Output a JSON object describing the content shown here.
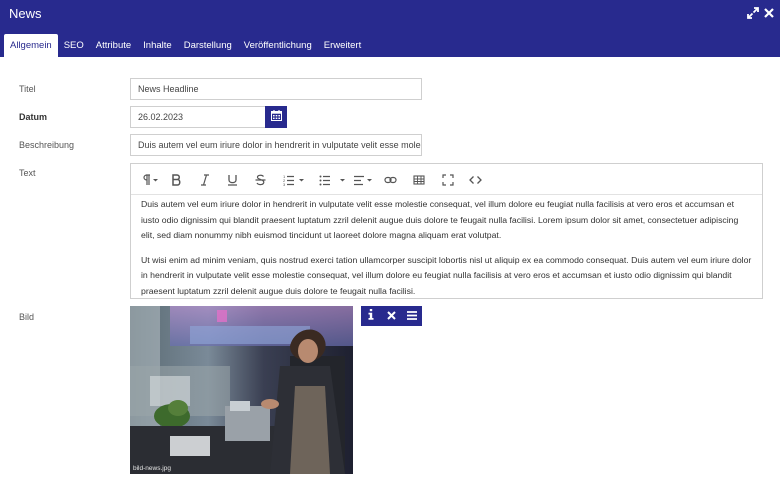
{
  "window": {
    "title": "News"
  },
  "tabs": [
    {
      "label": "Allgemein",
      "active": true
    },
    {
      "label": "SEO",
      "active": false
    },
    {
      "label": "Attribute",
      "active": false
    },
    {
      "label": "Inhalte",
      "active": false
    },
    {
      "label": "Darstellung",
      "active": false
    },
    {
      "label": "Veröffentlichung",
      "active": false
    },
    {
      "label": "Erweitert",
      "active": false
    }
  ],
  "form": {
    "title": {
      "label": "Titel",
      "value": "News Headline"
    },
    "date": {
      "label": "Datum",
      "value": "26.02.2023"
    },
    "description": {
      "label": "Beschreibung",
      "value": "Duis autem vel eum iriure dolor in hendrerit in vulputate velit esse molestie consequat"
    },
    "text": {
      "label": "Text",
      "paragraphs": [
        "Duis autem vel eum iriure dolor in hendrerit in vulputate velit esse molestie consequat, vel illum dolore eu feugiat nulla facilisis at vero eros et accumsan et iusto odio dignissim qui blandit praesent luptatum zzril delenit augue duis dolore te feugait nulla facilisi. Lorem ipsum dolor sit amet, consectetuer adipiscing elit, sed diam nonummy nibh euismod tincidunt ut laoreet dolore magna aliquam erat volutpat.",
        "Ut wisi enim ad minim veniam, quis nostrud exerci tation ullamcorper suscipit lobortis nisl ut aliquip ex ea commodo consequat. Duis autem vel eum iriure dolor in hendrerit in vulputate velit esse molestie consequat, vel illum dolore eu feugiat nulla facilisis at vero eros et accumsan et iusto odio dignissim qui blandit praesent luptatum zzril delenit augue duis dolore te feugait nulla facilisi."
      ]
    },
    "image": {
      "label": "Bild",
      "caption": "bild-news.jpg"
    }
  },
  "colors": {
    "primary": "#282a8e",
    "border": "#cfcfcf"
  },
  "icons": {
    "window": [
      "expand-icon",
      "close-icon"
    ],
    "date": "calendar-icon",
    "toolbar": [
      "paragraph-icon",
      "bold-icon",
      "italic-icon",
      "underline-icon",
      "strikethrough-icon",
      "ordered-list-icon",
      "unordered-list-icon",
      "align-icon",
      "link-icon",
      "table-icon",
      "fullscreen-icon",
      "code-icon"
    ],
    "image_actions": [
      "info-icon",
      "remove-icon",
      "menu-icon"
    ]
  }
}
